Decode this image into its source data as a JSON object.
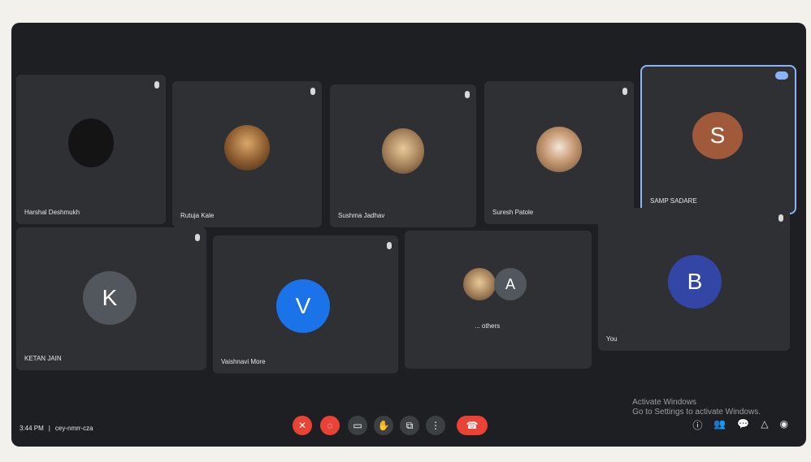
{
  "meeting": {
    "time": "3:44 PM",
    "code": "cey-nmrr-cza",
    "separator": "|"
  },
  "participants": [
    {
      "name": "Harshal Deshmukh",
      "avatar_letter": ""
    },
    {
      "name": "Rutuja Kale",
      "avatar_letter": ""
    },
    {
      "name": "Sushma Jadhav",
      "avatar_letter": ""
    },
    {
      "name": "Suresh Patole",
      "avatar_letter": ""
    },
    {
      "name": "SAMP SADARE",
      "avatar_letter": "S"
    },
    {
      "name": "KETAN JAIN",
      "avatar_letter": "K"
    },
    {
      "name": "Vaishnavi More",
      "avatar_letter": "V"
    },
    {
      "name": "... others",
      "avatar_letter": "A"
    },
    {
      "name": "You",
      "avatar_letter": "B"
    }
  ],
  "system_overlay": {
    "line1": "Activate Windows",
    "line2": "Go to Settings to activate Windows."
  },
  "colors": {
    "screen_bg": "#1d1f22",
    "tile_bg": "#2f3033",
    "accent": "#8ab4f8",
    "end_call": "#ea4335",
    "avatar_k": "#51575c",
    "avatar_v": "#1a73e8",
    "avatar_s": "#a05a3a",
    "avatar_b": "#3346a6"
  },
  "icons": {
    "mic_off": "mic-off-icon",
    "camera_off": "camera-off-icon",
    "captions": "captions-icon",
    "raise_hand": "hand-icon",
    "present": "present-icon",
    "more": "more-icon",
    "end_call": "end-call-icon",
    "info": "info-icon",
    "people": "people-icon",
    "chat": "chat-icon",
    "activities": "activities-icon",
    "host": "host-controls-icon"
  }
}
